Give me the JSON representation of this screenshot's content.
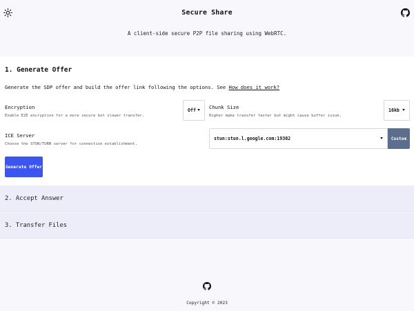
{
  "header": {
    "title": "Secure Share",
    "tagline": "A client-side secure P2P file sharing using WebRTC.",
    "theme_icon": "sun-icon",
    "repo_icon": "github-icon"
  },
  "generate": {
    "title": "1. Generate Offer",
    "description_prefix": "Generate the SDP offer and build the offer link following the options. See ",
    "description_link": "How does it work?",
    "encryption": {
      "label": "Encryption",
      "help": "Enable E2E encryption for a more secure but slower transfer.",
      "value": "Off"
    },
    "chunk_size": {
      "label": "Chunk Size",
      "help": "Higher make transfer faster but might cause buffer issue.",
      "value": "16kb"
    },
    "ice_server": {
      "label": "ICE Server",
      "help": "Choose the STUN/TURN server for connection establishment.",
      "value": "stun:stun.l.google.com:19302",
      "custom_label": "Custom"
    },
    "button_label": "Generate Offer"
  },
  "accept": {
    "title": "2. Accept Answer"
  },
  "transfer": {
    "title": "3. Transfer Files"
  },
  "footer": {
    "repo_icon": "github-icon",
    "copyright": "Copyright © 2023"
  },
  "colors": {
    "background": "#f7f7fc",
    "card": "#ffffff",
    "collapsed_section": "#ededfa",
    "primary_button": "#3b55f0",
    "custom_button": "#5b6e8e"
  }
}
